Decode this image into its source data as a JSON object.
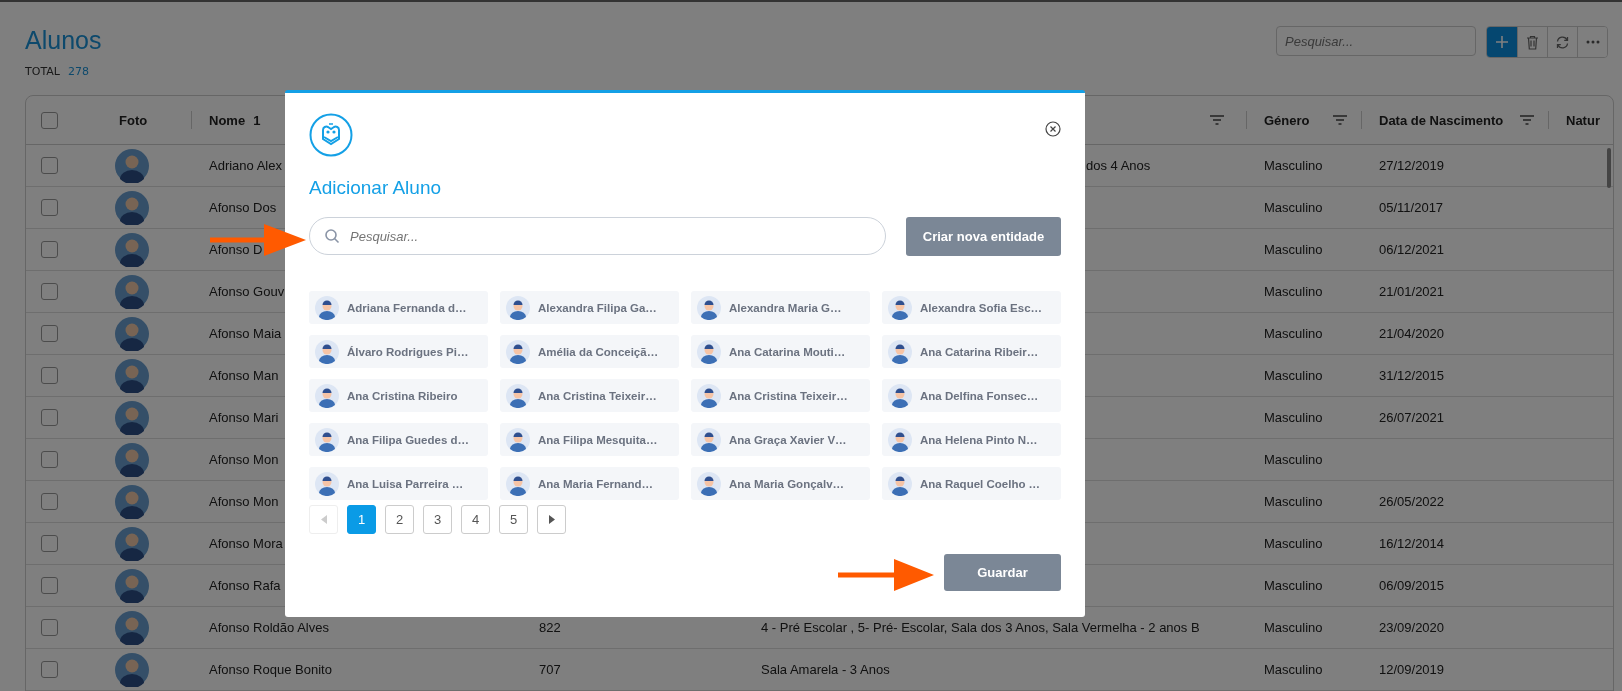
{
  "page": {
    "title": "Alunos",
    "total_label": "TOTAL",
    "total": "278",
    "search_placeholder": "Pesquisar..."
  },
  "toolbar": [
    {
      "kind": "add"
    },
    {
      "kind": "delete"
    },
    {
      "kind": "refresh"
    },
    {
      "kind": "more"
    }
  ],
  "table": {
    "columns": [
      {
        "kind": "check",
        "checked": false
      },
      {
        "kind": "text",
        "label": "Foto"
      },
      {
        "kind": "sorted",
        "label": "Nome",
        "sort_index": "1"
      },
      {
        "kind": "blank"
      },
      {
        "kind": "filter"
      },
      {
        "kind": "filter",
        "label": "Género"
      },
      {
        "kind": "filter",
        "label": "Data de Nascimento"
      },
      {
        "kind": "text",
        "label": "Natur"
      }
    ],
    "rows": [
      {
        "checked": false,
        "name": "Adriano Alex",
        "turma": {
          "text": "dos 4 Anos",
          "clipped": true
        },
        "genero": "Masculino",
        "data": "27/12/2019"
      },
      {
        "checked": false,
        "name": "Afonso Dos",
        "genero": "Masculino",
        "data": "05/11/2017"
      },
      {
        "checked": false,
        "name": "Afonso D",
        "genero": "Masculino",
        "data": "06/12/2021"
      },
      {
        "checked": false,
        "name": "Afonso Gouv",
        "genero": "Masculino",
        "data": "21/01/2021"
      },
      {
        "checked": false,
        "name": "Afonso Maia",
        "genero": "Masculino",
        "data": "21/04/2020"
      },
      {
        "checked": false,
        "name": "Afonso Man",
        "genero": "Masculino",
        "data": "31/12/2015"
      },
      {
        "checked": false,
        "name": "Afonso Mari",
        "genero": "Masculino",
        "data": "26/07/2021"
      },
      {
        "checked": false,
        "name": "Afonso Mon",
        "genero": "Masculino"
      },
      {
        "checked": false,
        "name": "Afonso Mon",
        "genero": "Masculino",
        "data": "26/05/2022"
      },
      {
        "checked": false,
        "name": "Afonso Mora",
        "genero": "Masculino",
        "data": "16/12/2014"
      },
      {
        "checked": false,
        "name": "Afonso Rafa",
        "genero": "Masculino",
        "data": "06/09/2015"
      },
      {
        "checked": false,
        "name": "Afonso Roldão Alves",
        "number": "822",
        "turma": {
          "text": "4 - Pré Escolar , 5- Pré- Escolar, Sala dos 3 Anos, Sala Vermelha - 2 anos B"
        },
        "genero": "Masculino",
        "data": "23/09/2020"
      },
      {
        "checked": false,
        "name": "Afonso Roque Bonito",
        "number": "707",
        "turma": {
          "text": "Sala Amarela - 3 Anos"
        },
        "genero": "Masculino",
        "data": "12/09/2019"
      }
    ]
  },
  "modal": {
    "title": "Adicionar Aluno",
    "search_placeholder": "Pesquisar...",
    "create_button": "Criar nova entidade",
    "students": [
      "Adriana Fernanda d…",
      "Alexandra Filipa Ga…",
      "Alexandra Maria G…",
      "Alexandra Sofia Esc…",
      "Álvaro Rodrigues Pi…",
      "Amélia da Conceiçã…",
      "Ana Catarina Mouti…",
      "Ana Catarina Ribeir…",
      "Ana Cristina Ribeiro",
      "Ana Cristina Teixeir…",
      "Ana Cristina Teixeir…",
      "Ana Delfina Fonsec…",
      "Ana Filipa Guedes d…",
      "Ana Filipa Mesquita…",
      "Ana Graça Xavier V…",
      "Ana Helena Pinto N…",
      "Ana Luisa Parreira …",
      "Ana Maria Fernand…",
      "Ana Maria Gonçalv…",
      "Ana Raquel Coelho …"
    ],
    "pagination": {
      "prev_disabled": true,
      "next_disabled": false,
      "pages": [
        {
          "label": "1",
          "selected": true
        },
        {
          "label": "2",
          "selected": false
        },
        {
          "label": "3",
          "selected": false
        },
        {
          "label": "4",
          "selected": false
        },
        {
          "label": "5",
          "selected": false
        }
      ]
    },
    "save_button": "Guardar"
  }
}
